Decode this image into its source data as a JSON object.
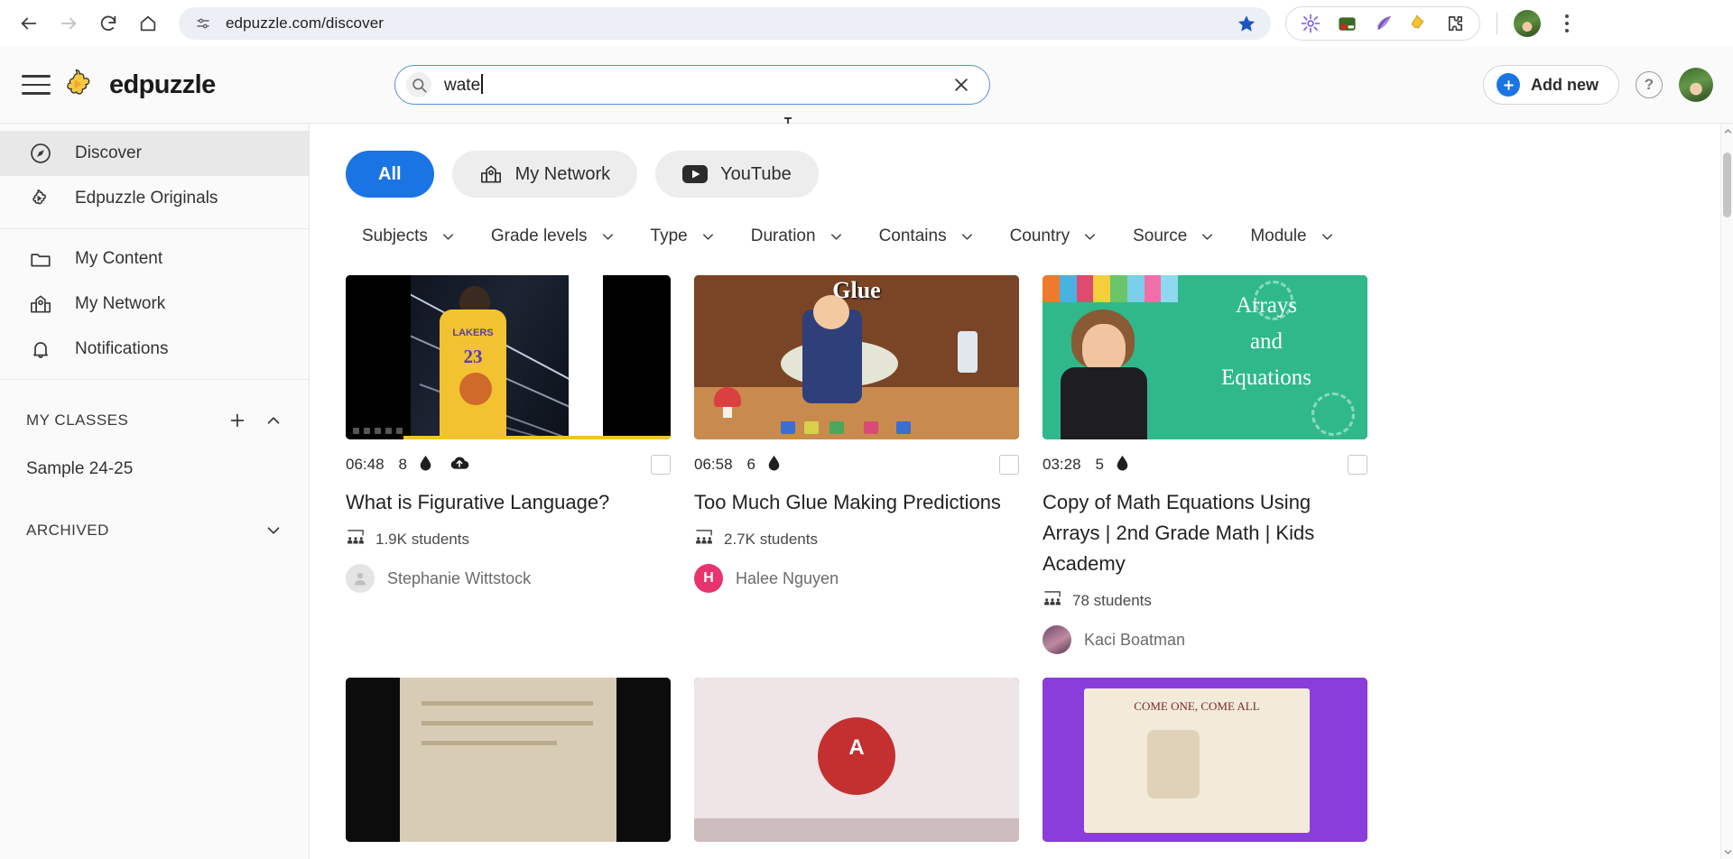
{
  "browser": {
    "back_label": "Back",
    "forward_label": "Forward",
    "reload_label": "Reload",
    "home_label": "Home",
    "url": "edpuzzle.com/discover",
    "site_info_icon": "tune-icon",
    "bookmark_icon": "star-filled-icon",
    "bookmark_color": "#1a56c4",
    "extensions": [
      {
        "name": "grammarly-extension-icon",
        "color": "#6d5ce7"
      },
      {
        "name": "screen-recorder-extension-icon",
        "color": "#3a6b22"
      },
      {
        "name": "quill-extension-icon",
        "color": "#8f6ed6"
      },
      {
        "name": "edpuzzle-extension-icon",
        "color": "#f5c431"
      },
      {
        "name": "extensions-puzzle-icon",
        "color": "#3c4043"
      }
    ],
    "profile_icon": "profile-avatar",
    "menu_icon": "kebab-menu-icon"
  },
  "header": {
    "menu_icon": "hamburger-menu-icon",
    "logo_icon": "edpuzzle-puzzle-logo",
    "brand": "edpuzzle",
    "search": {
      "icon": "search-icon",
      "value": "wate",
      "placeholder": "Search",
      "clear_icon": "close-x-icon"
    },
    "add_new": {
      "label": "Add new",
      "icon": "plus-icon",
      "accent": "#1b74e4"
    },
    "help": {
      "label": "?",
      "icon": "help-icon"
    },
    "avatar": "user-avatar"
  },
  "sidebar": {
    "primary": [
      {
        "label": "Discover",
        "icon": "compass-icon",
        "active": true
      },
      {
        "label": "Edpuzzle Originals",
        "icon": "puzzle-piece-icon",
        "active": false
      }
    ],
    "secondary": [
      {
        "label": "My Content",
        "icon": "folder-icon",
        "active": false
      },
      {
        "label": "My Network",
        "icon": "school-building-icon",
        "active": false
      },
      {
        "label": "Notifications",
        "icon": "bell-icon",
        "active": false
      }
    ],
    "classes": {
      "title": "MY CLASSES",
      "add_icon": "plus-icon",
      "collapse_icon": "chevron-up-icon",
      "items": [
        {
          "label": "Sample 24-25"
        }
      ]
    },
    "archived": {
      "title": "ARCHIVED",
      "expand_icon": "chevron-down-icon"
    }
  },
  "main": {
    "tabs": [
      {
        "label": "All",
        "icon": null,
        "active": true
      },
      {
        "label": "My Network",
        "icon": "school-building-icon",
        "active": false
      },
      {
        "label": "YouTube",
        "icon": "youtube-icon",
        "active": false
      }
    ],
    "filters": [
      {
        "label": "Subjects",
        "icon": "chevron-down-icon"
      },
      {
        "label": "Grade levels",
        "icon": "chevron-down-icon"
      },
      {
        "label": "Type",
        "icon": "chevron-down-icon"
      },
      {
        "label": "Duration",
        "icon": "chevron-down-icon"
      },
      {
        "label": "Contains",
        "icon": "chevron-down-icon"
      },
      {
        "label": "Country",
        "icon": "chevron-down-icon"
      },
      {
        "label": "Source",
        "icon": "chevron-down-icon"
      },
      {
        "label": "Module",
        "icon": "chevron-down-icon"
      }
    ],
    "cards": [
      {
        "duration": "06:48",
        "question_count": "8",
        "question_icon": "ink-drop-icon",
        "has_upload": true,
        "upload_icon": "cloud-upload-icon",
        "checkbox_icon": "checkbox-unchecked",
        "title": "What is Figurative Language?",
        "students": "1.9K students",
        "students_icon": "students-group-icon",
        "author": "Stephanie Wittstock",
        "author_initial": "",
        "author_avatar": "placeholder-person-avatar",
        "thumb": "lebron"
      },
      {
        "duration": "06:58",
        "question_count": "6",
        "question_icon": "ink-drop-icon",
        "has_upload": false,
        "upload_icon": "",
        "checkbox_icon": "checkbox-unchecked",
        "title": "Too Much Glue Making Predictions",
        "students": "2.7K students",
        "students_icon": "students-group-icon",
        "author": "Halee Nguyen",
        "author_initial": "H",
        "author_avatar": "initial-avatar",
        "thumb": "glue"
      },
      {
        "duration": "03:28",
        "question_count": "5",
        "question_icon": "ink-drop-icon",
        "has_upload": false,
        "upload_icon": "",
        "checkbox_icon": "checkbox-unchecked",
        "title": "Copy of Math Equations Using Arrays | 2nd Grade Math | Kids Academy",
        "students": "78 students",
        "students_icon": "students-group-icon",
        "author": "Kaci Boatman",
        "author_initial": "",
        "author_avatar": "photo-avatar",
        "thumb": "arrays"
      },
      {
        "thumb": "book"
      },
      {
        "thumb": "apple"
      },
      {
        "thumb": "circus"
      }
    ],
    "scrollbar": {
      "name": "main-scrollbar"
    }
  },
  "colors": {
    "accent_blue": "#1b74e4",
    "pink_avatar": "#e8336d",
    "sidebar_bg": "#fafafa",
    "active_item_bg": "#e8e8e8"
  }
}
